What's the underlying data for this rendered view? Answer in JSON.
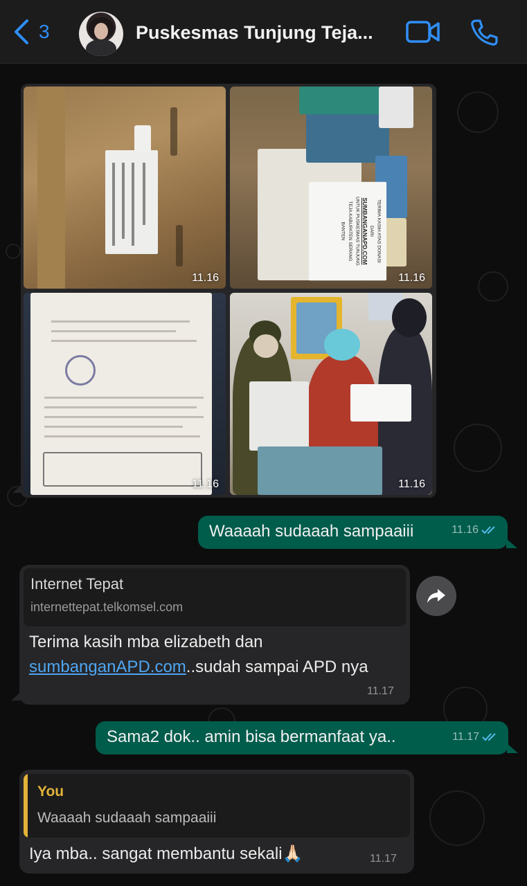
{
  "header": {
    "back_count": "3",
    "chat_title": "Puskesmas Tunjung Teja...",
    "accent_color": "#2f8ff7"
  },
  "album": {
    "photos": [
      {
        "name": "package-photo",
        "time": "11.16"
      },
      {
        "name": "donation-box-photo",
        "time": "11.16",
        "note_lines": [
          "TERIMA KASIH ATAS DONASI",
          "DARI",
          "SUMBANGANAPD.COM",
          "UNTUK PUSKESMAS TUNJUNG",
          "TEJA KABUPATEN SERANG",
          "BANTEN"
        ]
      },
      {
        "name": "letter-photo",
        "time": "11.16"
      },
      {
        "name": "staff-photo",
        "time": "11.16"
      }
    ]
  },
  "messages": [
    {
      "dir": "out",
      "text": "Waaaah sudaaah sampaaiii",
      "time": "11.16",
      "status": "read"
    },
    {
      "dir": "in",
      "link_preview": {
        "title": "Internet Tepat",
        "host": "internettepat.telkomsel.com"
      },
      "text_before": "Terima kasih mba elizabeth dan",
      "link_text": "sumbanganAPD.com",
      "text_after": "..sudah sampai APD nya",
      "time": "11.17"
    },
    {
      "dir": "out",
      "text": "Sama2 dok.. amin bisa bermanfaat ya..",
      "time": "11.17",
      "status": "read"
    },
    {
      "dir": "in",
      "quote": {
        "author": "You",
        "text": "Waaaah sudaaah sampaaiii"
      },
      "text": "Iya mba.. sangat membantu sekali🙏🏻",
      "time": "11.17"
    }
  ],
  "colors": {
    "outgoing_bubble": "#005c4b",
    "incoming_bubble": "#262628",
    "read_ticks": "#53bdeb",
    "quote_accent": "#e3b339"
  }
}
